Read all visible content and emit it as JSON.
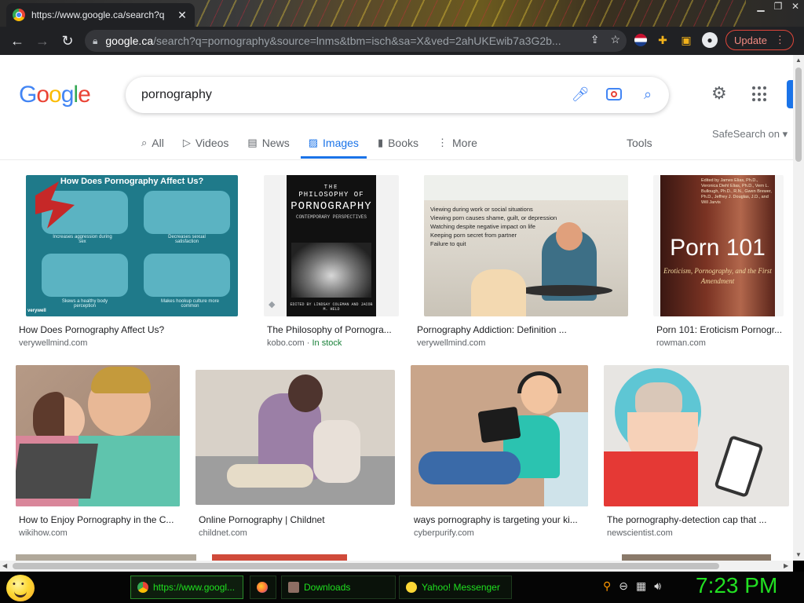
{
  "browser": {
    "tab_title": "https://www.google.ca/search?q",
    "url_host": "google.ca",
    "url_rest": "/search?q=pornography&source=lnms&tbm=isch&sa=X&ved=2ahUKEwib7a3G2b...",
    "update_label": "Update"
  },
  "google": {
    "logo": [
      "G",
      "o",
      "o",
      "g",
      "l",
      "e"
    ],
    "query": "pornography",
    "tabs": [
      {
        "label": "All",
        "icon": "search-icon",
        "glyph": "⌕",
        "active": false
      },
      {
        "label": "Videos",
        "icon": "play-icon",
        "glyph": "▷",
        "active": false
      },
      {
        "label": "News",
        "icon": "news-icon",
        "glyph": "▤",
        "active": false
      },
      {
        "label": "Images",
        "icon": "image-icon",
        "glyph": "▨",
        "active": true
      },
      {
        "label": "Books",
        "icon": "book-icon",
        "glyph": "▮",
        "active": false
      },
      {
        "label": "More",
        "icon": "more-vert-icon",
        "glyph": "⋮",
        "active": false
      }
    ],
    "tools_label": "Tools",
    "safesearch_label": "SafeSearch on"
  },
  "results": [
    {
      "caption": "How Does Pornography Affect Us?",
      "source": "verywellmind.com",
      "badge": ""
    },
    {
      "caption": "The Philosophy of Pornogra...",
      "source": "kobo.com",
      "badge": "In stock"
    },
    {
      "caption": "Pornography Addiction: Definition ...",
      "source": "verywellmind.com",
      "badge": ""
    },
    {
      "caption": "Porn 101: Eroticism Pornogr...",
      "source": "rowman.com",
      "badge": ""
    },
    {
      "caption": "How to Enjoy Pornography in the C...",
      "source": "wikihow.com",
      "badge": ""
    },
    {
      "caption": "Online Pornography | Childnet",
      "source": "childnet.com",
      "badge": ""
    },
    {
      "caption": "ways pornography is targeting your ki...",
      "source": "cyberpurify.com",
      "badge": ""
    },
    {
      "caption": "The pornography-detection cap that ...",
      "source": "newscientist.com",
      "badge": ""
    }
  ],
  "image_text": {
    "r1_heading": "How Does Pornography Affect Us?",
    "r1_panels": [
      "Increases aggression during sex",
      "Decreases sexual satisfaction",
      "Skews a healthy body perception",
      "Makes hookup culture more common"
    ],
    "r1_brand": "verywell",
    "r2_title_1": "THE",
    "r2_title_2": "PHILOSOPHY OF",
    "r2_title_3": "PORNOGRAPHY",
    "r2_subtitle": "CONTEMPORARY PERSPECTIVES",
    "r2_editors": "EDITED BY LINDSAY COLEMAN AND JACOB M. HELD",
    "r3_lines": [
      "Viewing during work or social situations",
      "Viewing porn causes shame, guilt, or depression",
      "Watching despite negative impact on life",
      "Keeping porn secret from partner",
      "Failure to quit"
    ],
    "r4_editors": "Edited by James Elias, Ph.D., Veronica Diehl Elias, Ph.D., Vern L. Bullough, Ph.D., R.N., Gwen Brewer, Ph.D., Jeffrey J. Douglas, J.D., and Will Jarvis",
    "r4_title": "Porn 101",
    "r4_subtitle": "Eroticism, Pornography, and the First Amendment"
  },
  "taskbar": {
    "buttons": [
      {
        "label": "https://www.googl...",
        "color": "#4285f4"
      },
      {
        "label": "",
        "color": "#ff7139"
      },
      {
        "label": "Downloads",
        "color": "#8d6e63"
      },
      {
        "label": "Yahoo! Messenger",
        "color": "#fdd835"
      }
    ],
    "clock": "7:23 PM"
  }
}
